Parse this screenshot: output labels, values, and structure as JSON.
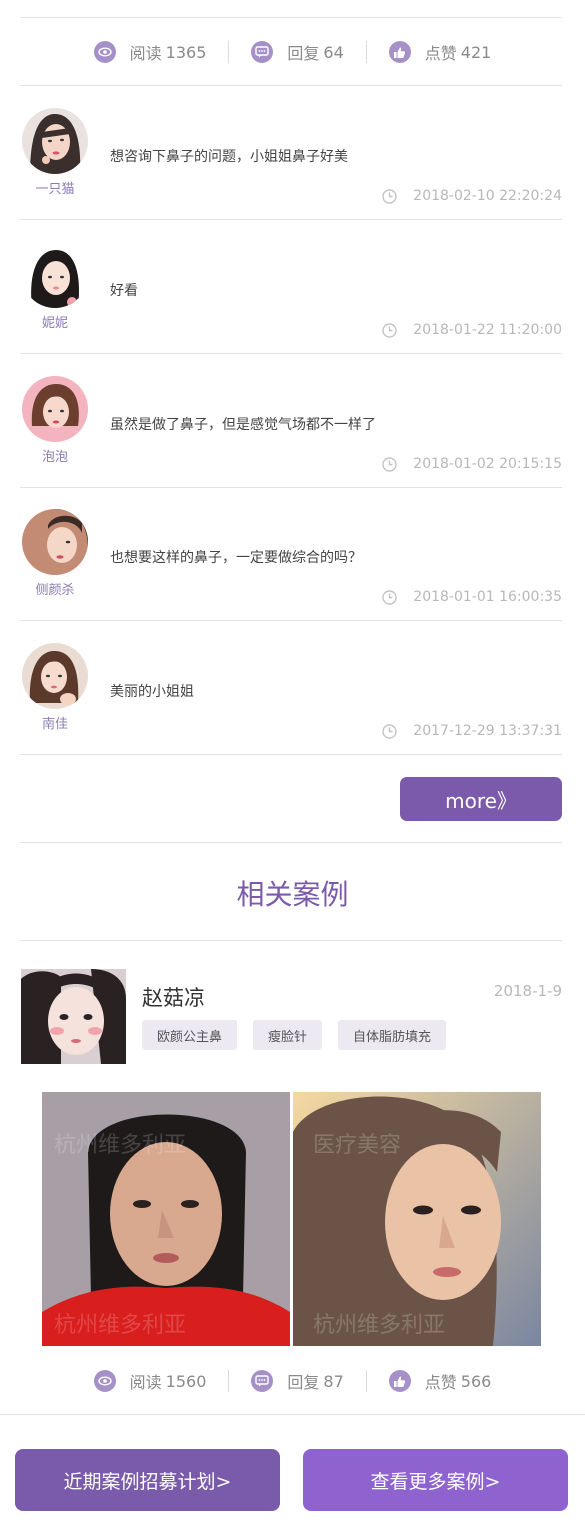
{
  "top_stats": {
    "read_label": "阅读",
    "read_count": "1365",
    "reply_label": "回复",
    "reply_count": "64",
    "like_label": "点赞",
    "like_count": "421"
  },
  "comments": [
    {
      "name": "一只猫",
      "text": "想咨询下鼻子的问题，小姐姐鼻子好美",
      "time": "2018-02-10 22:20:24"
    },
    {
      "name": "妮妮",
      "text": "好看",
      "time": "2018-01-22 11:20:00"
    },
    {
      "name": "泡泡",
      "text": "虽然是做了鼻子，但是感觉气场都不一样了",
      "time": "2018-01-02 20:15:15"
    },
    {
      "name": "侧颜杀",
      "text": "也想要这样的鼻子，一定要做综合的吗？",
      "time": "2018-01-01 16:00:35"
    },
    {
      "name": "南佳",
      "text": "美丽的小姐姐",
      "time": "2017-12-29 13:37:31"
    }
  ],
  "more_label": "more》",
  "related": {
    "title": "相关案例",
    "case": {
      "name": "赵菇凉",
      "date": "2018-1-9",
      "tags": [
        "欧颜公主鼻",
        "瘦脸针",
        "自体脂肪填充"
      ],
      "watermark": "杭州维多利亚医疗美容"
    }
  },
  "case_stats": {
    "read_label": "阅读",
    "read_count": "1560",
    "reply_label": "回复",
    "reply_count": "87",
    "like_label": "点赞",
    "like_count": "566"
  },
  "bottom_buttons": {
    "left": "近期案例招募计划>",
    "right": "查看更多案例>"
  },
  "colors": {
    "accent": "#7b5aab",
    "accent_light": "#8e63d0",
    "icon": "#a591c8"
  }
}
